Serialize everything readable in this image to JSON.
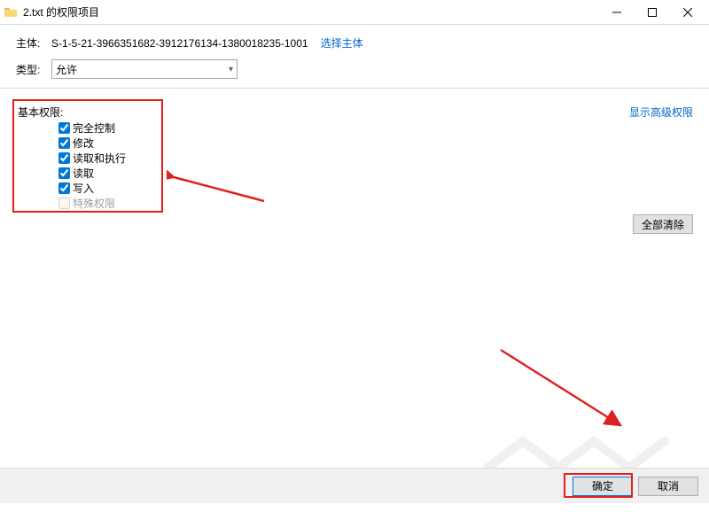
{
  "titlebar": {
    "title": "2.txt 的权限项目"
  },
  "header": {
    "principal_label": "主体:",
    "principal_sid": "S-1-5-21-3966351682-3912176134-1380018235-1001",
    "select_principal_link": "选择主体",
    "type_label": "类型:",
    "type_value": "允许"
  },
  "permissions": {
    "title": "基本权限:",
    "show_advanced": "显示高级权限",
    "items": [
      {
        "label": "完全控制",
        "checked": true,
        "enabled": true
      },
      {
        "label": "修改",
        "checked": true,
        "enabled": true
      },
      {
        "label": "读取和执行",
        "checked": true,
        "enabled": true
      },
      {
        "label": "读取",
        "checked": true,
        "enabled": true
      },
      {
        "label": "写入",
        "checked": true,
        "enabled": true
      },
      {
        "label": "特殊权限",
        "checked": false,
        "enabled": false
      }
    ],
    "clear_all": "全部清除"
  },
  "footer": {
    "ok": "确定",
    "cancel": "取消"
  }
}
